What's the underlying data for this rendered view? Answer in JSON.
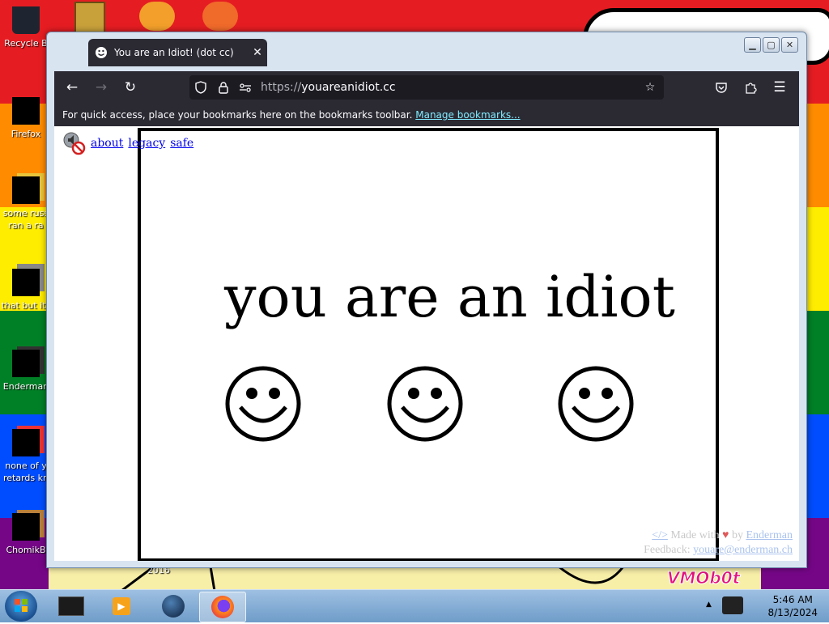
{
  "desktop": {
    "icons": [
      {
        "label": "Recycle B"
      },
      {
        "label": "Firefox"
      },
      {
        "label": "some russ\nran a ra"
      },
      {
        "label": "that but its"
      },
      {
        "label": "Enderman"
      },
      {
        "label": "none of y\nretards kn"
      },
      {
        "label": "ChomikB"
      }
    ],
    "wallpaper_text": {
      "year": "2016",
      "signature": "VMOb0t"
    },
    "rainbow_colors": [
      "#e51d22",
      "#ff8c00",
      "#ffed00",
      "#008026",
      "#004dff",
      "#750787"
    ]
  },
  "browser": {
    "tab_title": "You are an Idiot! (dot cc)",
    "url_scheme": "https://",
    "url_host": "youareanidiot.cc",
    "bookmarks_prompt": "For quick access, place your bookmarks here on the bookmarks toolbar.",
    "bookmarks_link": "Manage bookmarks...",
    "accent_link_color": "#80ebff"
  },
  "page": {
    "links": [
      "about",
      "legacy",
      "safe"
    ],
    "headline": "you are an idiot",
    "credits": {
      "made_with_prefix": "Made with",
      "by": "by",
      "author": "Enderman",
      "feedback_label": "Feedback:",
      "feedback_email": "youare@enderman.ch"
    }
  },
  "taskbar": {
    "time": "5:46 AM",
    "date": "8/13/2024"
  }
}
